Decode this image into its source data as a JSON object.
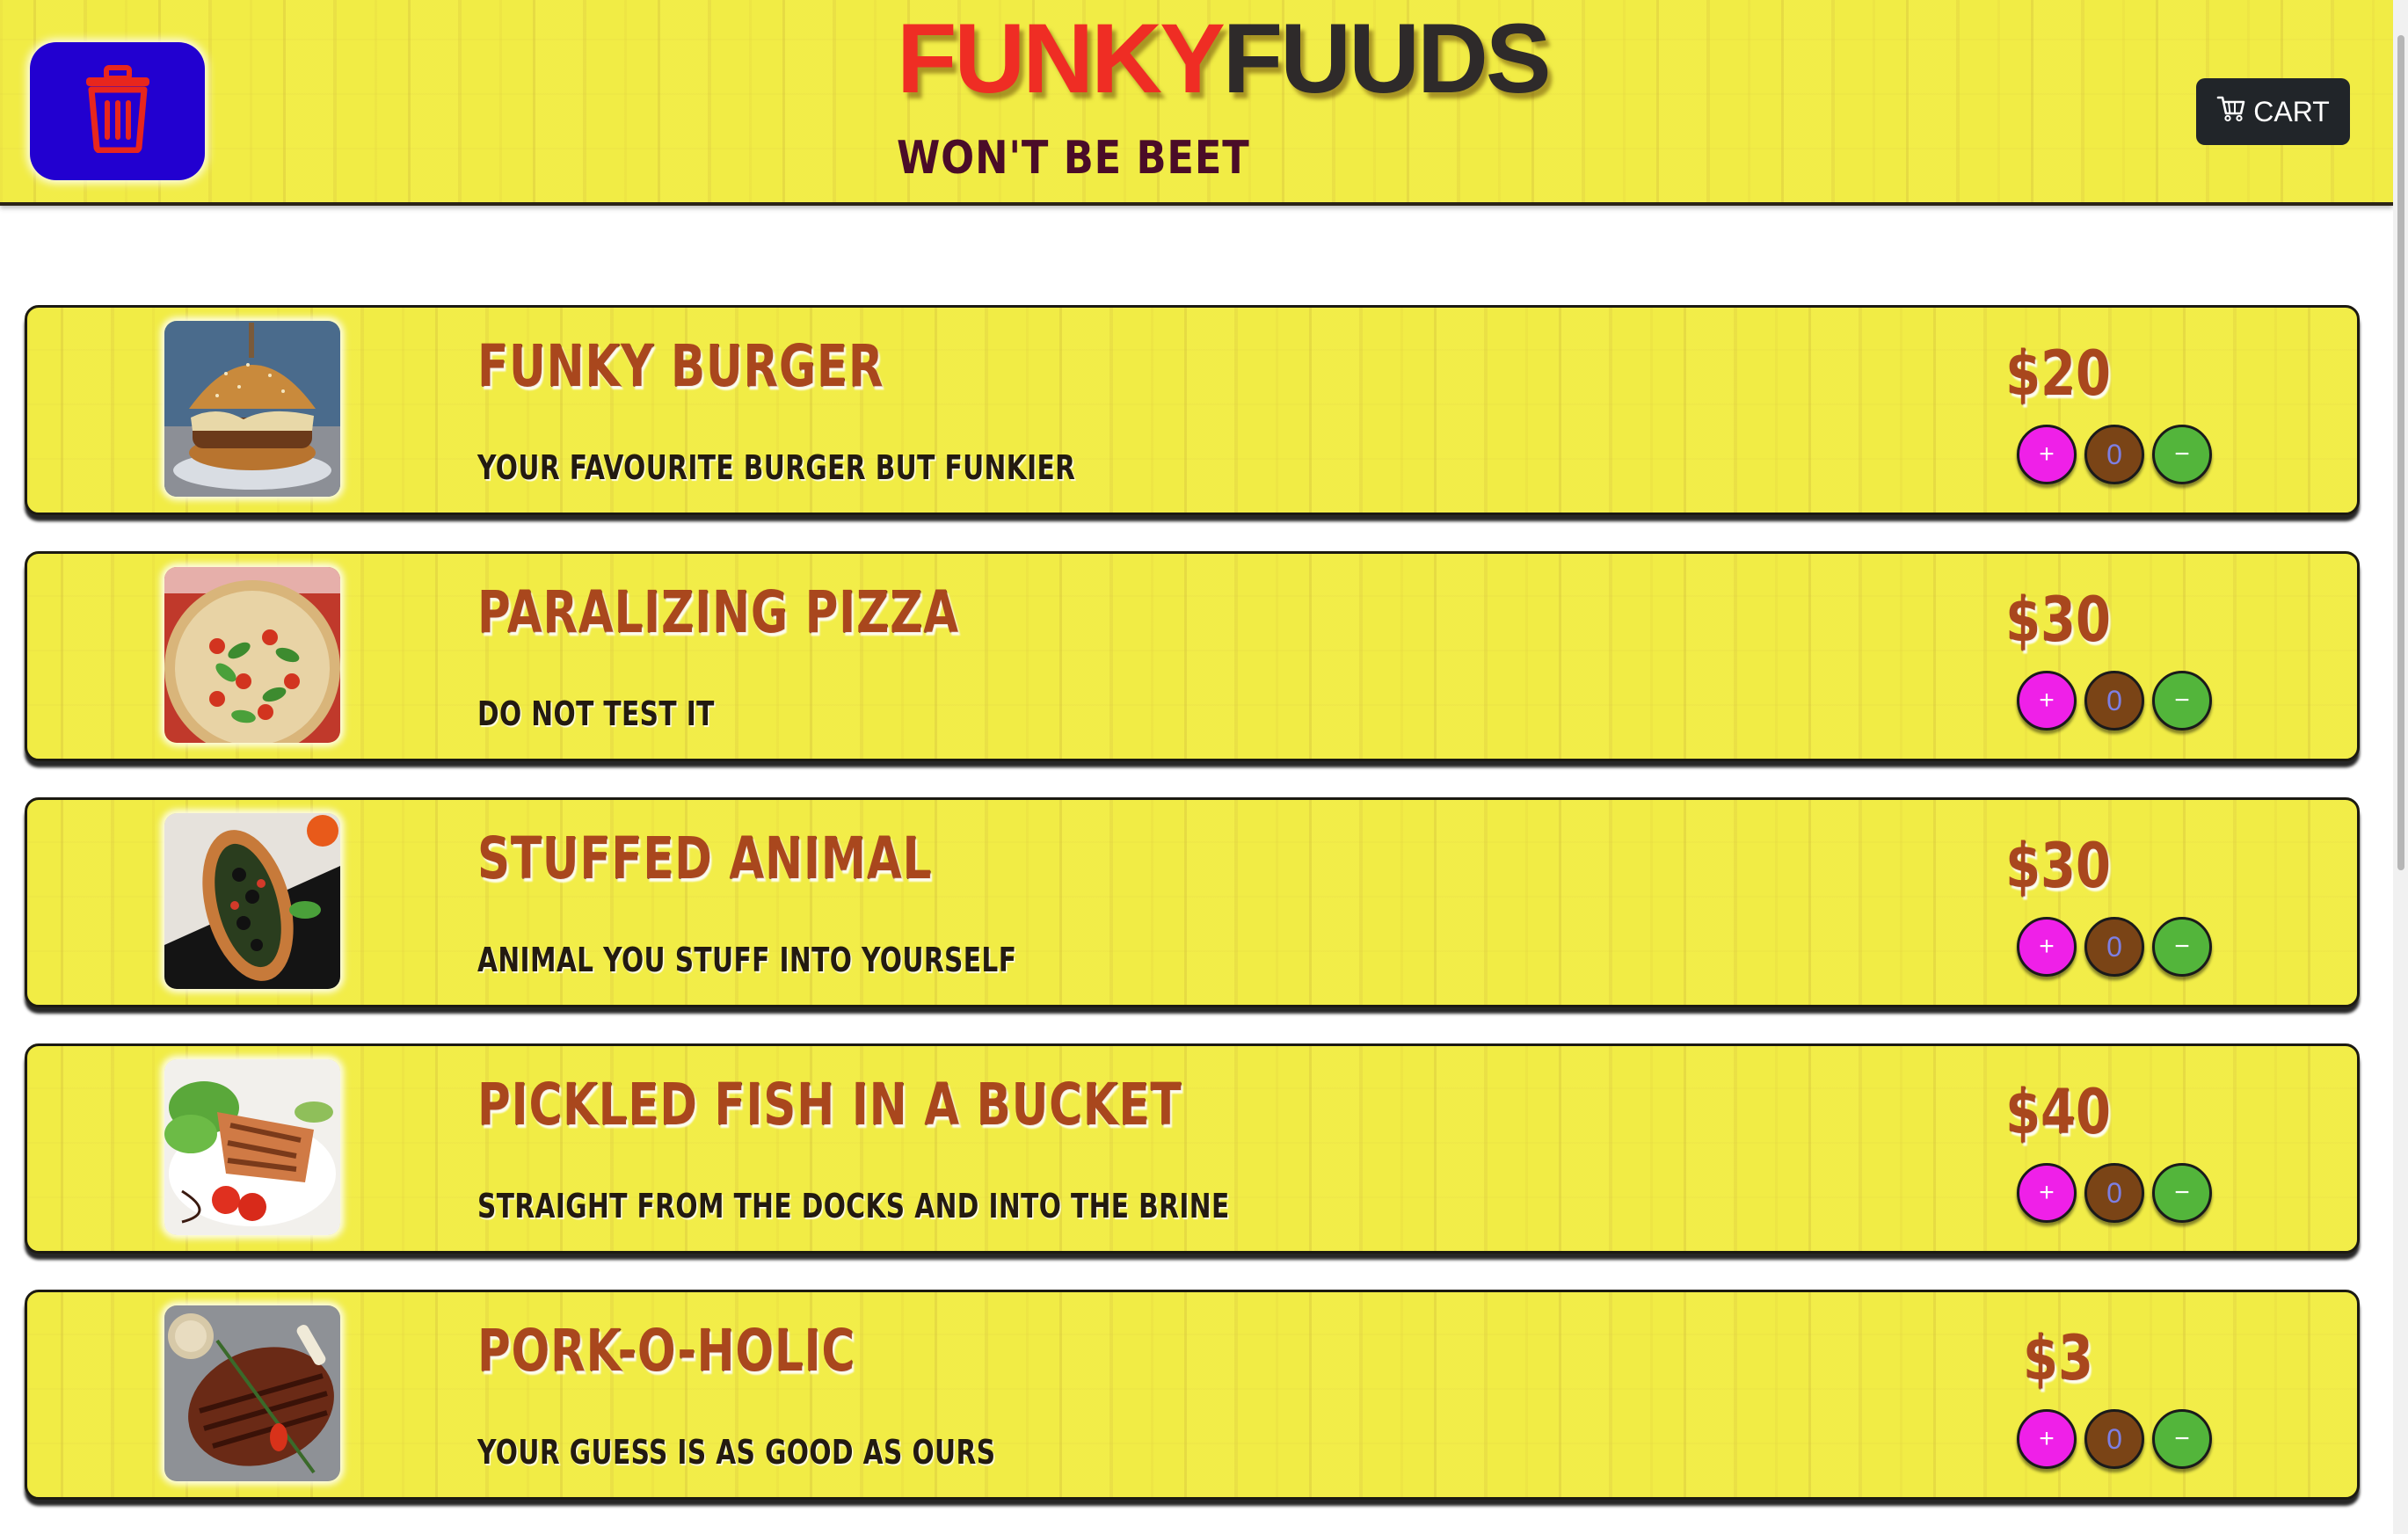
{
  "header": {
    "brand_part1": "FUNKY",
    "brand_part2": "FUUDS",
    "tagline": "WON'T BE BEET",
    "clear_icon": "trash-icon",
    "cart_icon": "cart-icon",
    "cart_label": "CART"
  },
  "menu": {
    "items": [
      {
        "title": "FUNKY BURGER",
        "description": "YOUR FAVOURITE BURGER BUT FUNKIER",
        "price": "$20",
        "quantity": "0",
        "plus_label": "+",
        "minus_label": "−",
        "image": "burger"
      },
      {
        "title": "PARALIZING PIZZA",
        "description": "DO NOT TEST IT",
        "price": "$30",
        "quantity": "0",
        "plus_label": "+",
        "minus_label": "−",
        "image": "pizza"
      },
      {
        "title": "STUFFED ANIMAL",
        "description": "ANIMAL YOU STUFF INTO YOURSELF",
        "price": "$30",
        "quantity": "0",
        "plus_label": "+",
        "minus_label": "−",
        "image": "stuffed-bread"
      },
      {
        "title": "PICKLED FISH IN A BUCKET",
        "description": "STRAIGHT FROM THE DOCKS AND INTO THE BRINE",
        "price": "$40",
        "quantity": "0",
        "plus_label": "+",
        "minus_label": "−",
        "image": "salmon"
      },
      {
        "title": "PORK-O-HOLIC",
        "description": "YOUR GUESS IS AS GOOD AS OURS",
        "price": "$3",
        "quantity": "0",
        "plus_label": "+",
        "minus_label": "−",
        "image": "pork-ribs"
      }
    ]
  },
  "colors": {
    "brand_red": "#ef2d24",
    "brand_dark": "#2e2a2a",
    "plus_button": "#ef20e8",
    "minus_button": "#53b53b",
    "quantity_bg": "#7a4416",
    "clear_button": "#2200d0",
    "cart_button": "#212529"
  }
}
